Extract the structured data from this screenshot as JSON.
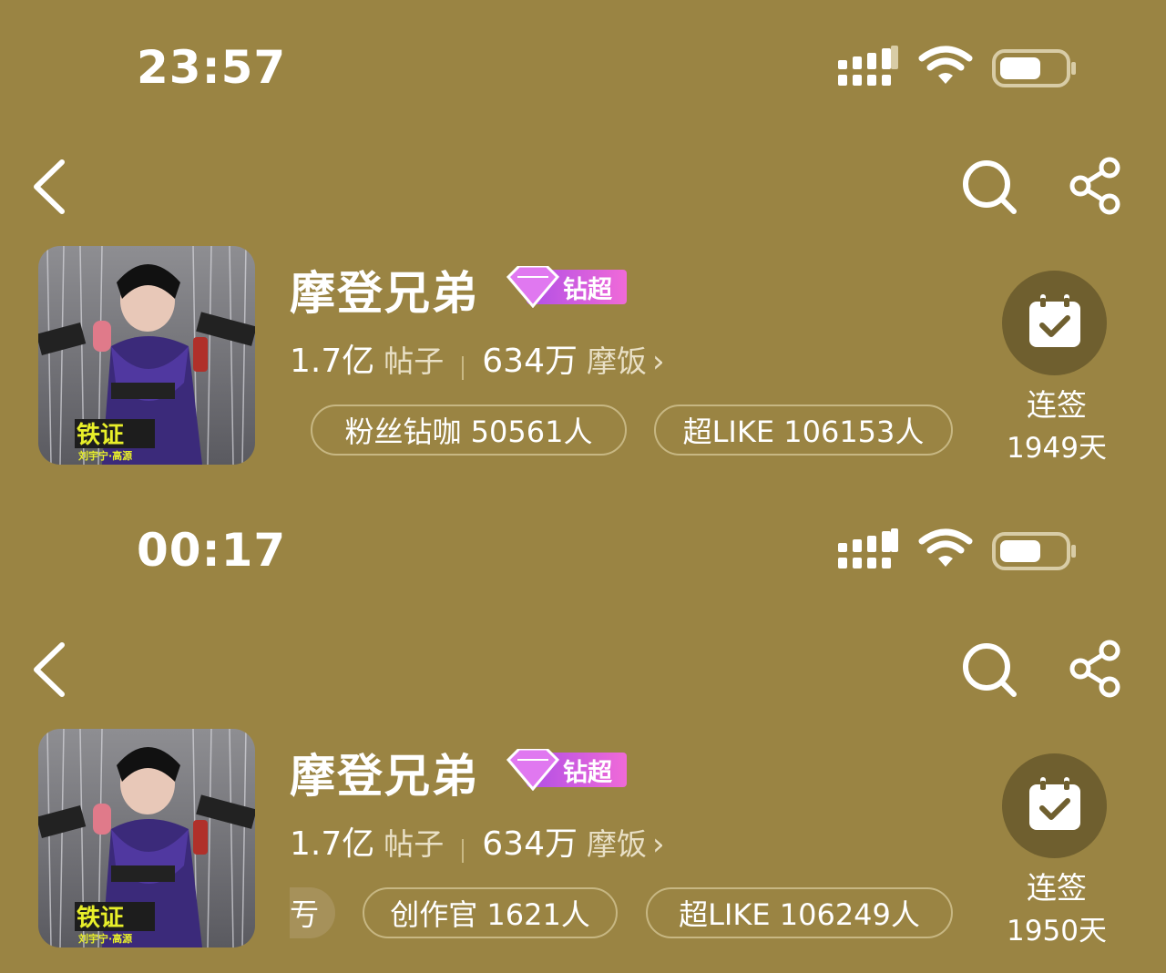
{
  "colors": {
    "background": "#9a8443",
    "badge_gradient_start": "#b04fe6",
    "badge_gradient_end": "#f06ad8",
    "checkin_bg": "#6f5f2f"
  },
  "panels": [
    {
      "status_bar": {
        "time": "23:57"
      },
      "nav": {
        "back_icon": "back-chevron-icon",
        "search_icon": "search-icon",
        "share_icon": "share-icon"
      },
      "topic": {
        "title": "摩登兄弟",
        "badge_label": "钻超",
        "posts_count": "1.7亿",
        "posts_unit": "帖子",
        "fans_count": "634万",
        "fans_unit": "摩饭",
        "pills": [
          {
            "label": "粉丝钻咖 50561人"
          },
          {
            "label": "超LIKE 106153人"
          }
        ],
        "partial_pill_text": "",
        "checkin_label": "连签",
        "checkin_days": "1949天"
      }
    },
    {
      "status_bar": {
        "time": "00:17"
      },
      "nav": {
        "back_icon": "back-chevron-icon",
        "search_icon": "search-icon",
        "share_icon": "share-icon"
      },
      "topic": {
        "title": "摩登兄弟",
        "badge_label": "钻超",
        "posts_count": "1.7亿",
        "posts_unit": "帖子",
        "fans_count": "634万",
        "fans_unit": "摩饭",
        "pills": [
          {
            "label": "创作官 1621人"
          },
          {
            "label": "超LIKE 106249人"
          }
        ],
        "partial_pill_text": "亐",
        "checkin_label": "连签",
        "checkin_days": "1950天"
      }
    }
  ]
}
